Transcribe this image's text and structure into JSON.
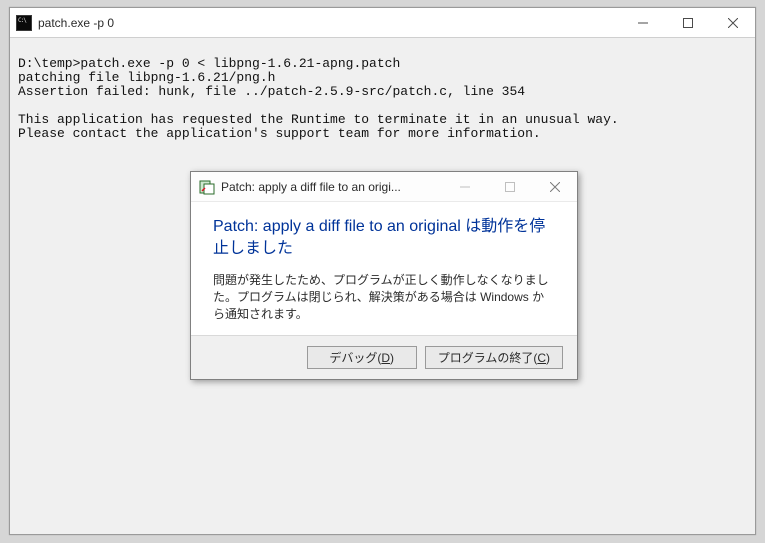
{
  "console": {
    "title": "patch.exe -p 0",
    "lines": [
      "D:\\temp>patch.exe -p 0 < libpng-1.6.21-apng.patch",
      "patching file libpng-1.6.21/png.h",
      "Assertion failed: hunk, file ../patch-2.5.9-src/patch.c, line 354",
      "",
      "This application has requested the Runtime to terminate it in an unusual way.",
      "Please contact the application's support team for more information."
    ]
  },
  "dialog": {
    "title": "Patch: apply a diff file to an origi...",
    "headline": "Patch: apply a diff file to an original は動作を停止しました",
    "message": "問題が発生したため、プログラムが正しく動作しなくなりました。プログラムは閉じられ、解決策がある場合は Windows から通知されます。",
    "buttons": {
      "debug": "デバッグ(D)",
      "close": "プログラムの終了(C)"
    }
  }
}
